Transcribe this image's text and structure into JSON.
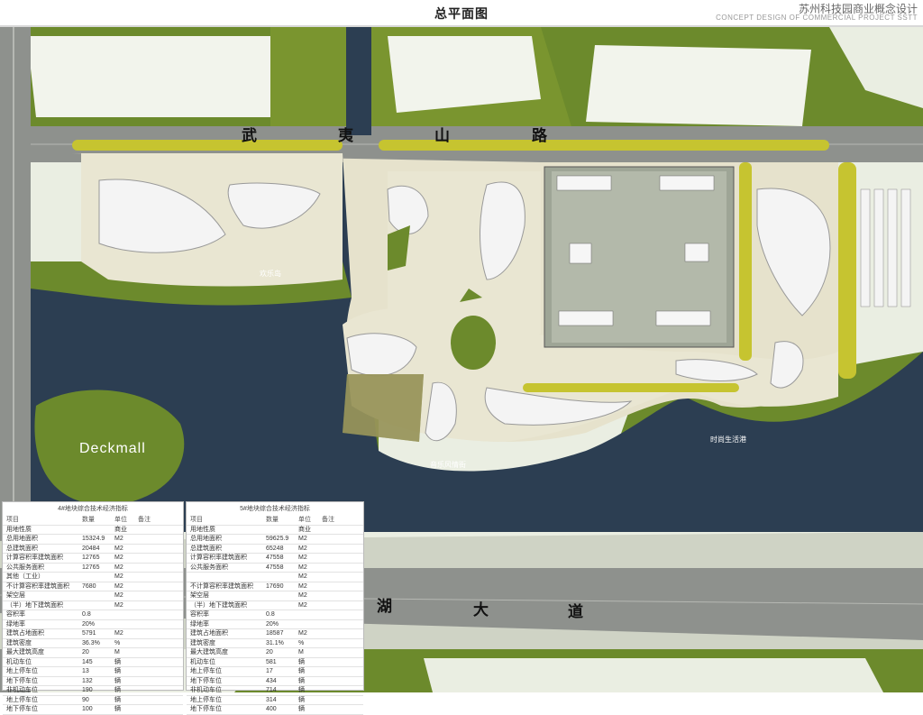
{
  "header": {
    "page_title": "总平面图",
    "project_title": "苏州科技园商业概念设计",
    "project_subtitle": "CONCEPT DESIGN OF COMMERCIAL PROJECT SSTT"
  },
  "plan": {
    "road_north_chars": [
      "武",
      "夷",
      "山",
      "路"
    ],
    "road_south_chars": [
      "湖",
      "大",
      "道"
    ],
    "deckmall_label": "Deckmall",
    "place_labels": [
      "欢乐岛",
      "音乐风情街",
      "时尚生活港"
    ]
  },
  "colors": {
    "water": "#2c3e52",
    "road": "#8e918d",
    "green": "#6c8a2c",
    "building": "#f4f4f4",
    "plaza": "#e6e2cc",
    "trees": "#c6c430"
  },
  "tables": [
    {
      "title": "4#地块综合技术经济指标",
      "headers": [
        "项目",
        "数量",
        "单位",
        "备注"
      ],
      "rows": [
        {
          "name": "用地性质",
          "qty": "",
          "unit": "商业",
          "note": ""
        },
        {
          "name": "总用地面积",
          "qty": "15324.9",
          "unit": "M2",
          "note": ""
        },
        {
          "name": "总建筑面积",
          "qty": "20484",
          "unit": "M2",
          "note": ""
        },
        {
          "name": "计算容积率建筑面积",
          "qty": "12765",
          "unit": "M2",
          "note": ""
        },
        {
          "name": "公共服务面积",
          "qty": "12765",
          "unit": "M2",
          "note": ""
        },
        {
          "name": "其他（工业）",
          "qty": "",
          "unit": "M2",
          "note": ""
        },
        {
          "name": "不计算容积率建筑面积",
          "qty": "7680",
          "unit": "M2",
          "note": ""
        },
        {
          "name": "架空层",
          "qty": "",
          "unit": "M2",
          "note": ""
        },
        {
          "name": "（半）地下建筑面积",
          "qty": "",
          "unit": "M2",
          "note": ""
        },
        {
          "name": "容积率",
          "qty": "0.8",
          "unit": "",
          "note": ""
        },
        {
          "name": "绿地率",
          "qty": "20%",
          "unit": "",
          "note": ""
        },
        {
          "name": "建筑占地面积",
          "qty": "5791",
          "unit": "M2",
          "note": ""
        },
        {
          "name": "建筑密度",
          "qty": "36.3%",
          "unit": "%",
          "note": ""
        },
        {
          "name": "最大建筑高度",
          "qty": "20",
          "unit": "M",
          "note": ""
        },
        {
          "name": "机动车位",
          "qty": "145",
          "unit": "辆",
          "note": ""
        },
        {
          "name": "地上停车位",
          "qty": "13",
          "unit": "辆",
          "note": ""
        },
        {
          "name": "地下停车位",
          "qty": "132",
          "unit": "辆",
          "note": ""
        },
        {
          "name": "非机动车位",
          "qty": "190",
          "unit": "辆",
          "note": ""
        },
        {
          "name": "地上停车位",
          "qty": "90",
          "unit": "辆",
          "note": ""
        },
        {
          "name": "地下停车位",
          "qty": "100",
          "unit": "辆",
          "note": ""
        }
      ]
    },
    {
      "title": "5#地块综合技术经济指标",
      "headers": [
        "项目",
        "数量",
        "单位",
        "备注"
      ],
      "rows": [
        {
          "name": "用地性质",
          "qty": "",
          "unit": "商业",
          "note": ""
        },
        {
          "name": "总用地面积",
          "qty": "59625.9",
          "unit": "M2",
          "note": ""
        },
        {
          "name": "总建筑面积",
          "qty": "65248",
          "unit": "M2",
          "note": ""
        },
        {
          "name": "计算容积率建筑面积",
          "qty": "47558",
          "unit": "M2",
          "note": ""
        },
        {
          "name": "公共服务面积",
          "qty": "47558",
          "unit": "M2",
          "note": ""
        },
        {
          "name": "",
          "qty": "",
          "unit": "M2",
          "note": ""
        },
        {
          "name": "不计算容积率建筑面积",
          "qty": "17690",
          "unit": "M2",
          "note": ""
        },
        {
          "name": "架空层",
          "qty": "",
          "unit": "M2",
          "note": ""
        },
        {
          "name": "（半）地下建筑面积",
          "qty": "",
          "unit": "M2",
          "note": ""
        },
        {
          "name": "容积率",
          "qty": "0.8",
          "unit": "",
          "note": ""
        },
        {
          "name": "绿地率",
          "qty": "20%",
          "unit": "",
          "note": ""
        },
        {
          "name": "建筑占地面积",
          "qty": "18587",
          "unit": "M2",
          "note": ""
        },
        {
          "name": "建筑密度",
          "qty": "31.1%",
          "unit": "%",
          "note": ""
        },
        {
          "name": "最大建筑高度",
          "qty": "20",
          "unit": "M",
          "note": ""
        },
        {
          "name": "机动车位",
          "qty": "581",
          "unit": "辆",
          "note": ""
        },
        {
          "name": "地上停车位",
          "qty": "17",
          "unit": "辆",
          "note": ""
        },
        {
          "name": "地下停车位",
          "qty": "434",
          "unit": "辆",
          "note": ""
        },
        {
          "name": "非机动车位",
          "qty": "714",
          "unit": "辆",
          "note": ""
        },
        {
          "name": "地上停车位",
          "qty": "314",
          "unit": "辆",
          "note": ""
        },
        {
          "name": "地下停车位",
          "qty": "400",
          "unit": "辆",
          "note": ""
        }
      ]
    }
  ]
}
